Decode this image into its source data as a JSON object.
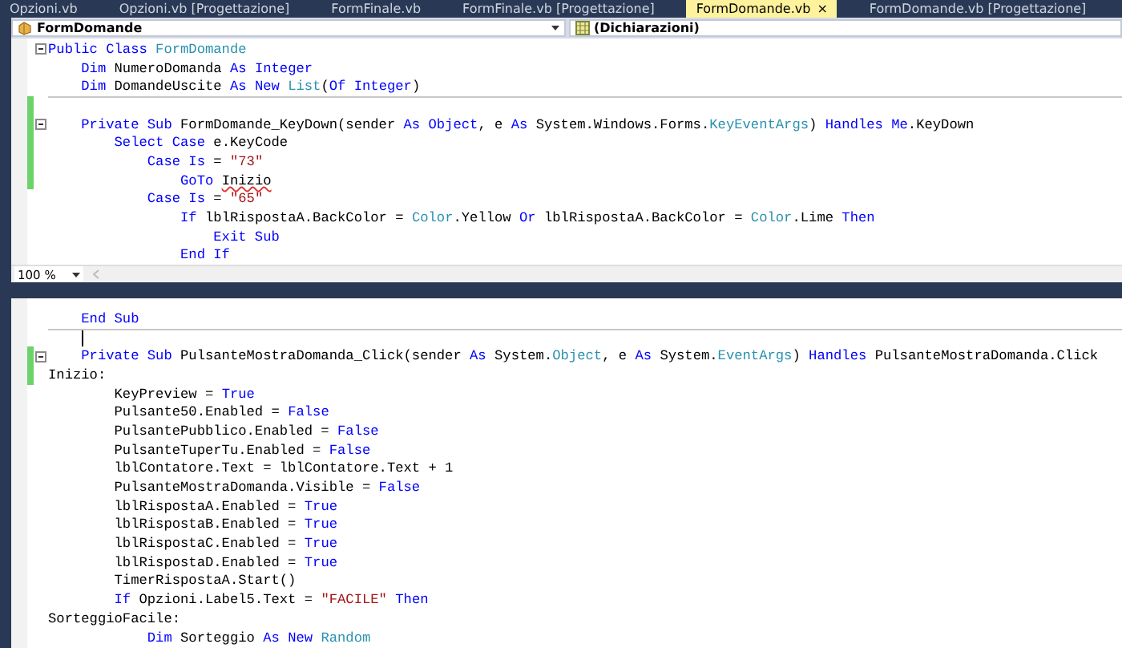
{
  "tabs": [
    {
      "label": "Opzioni.vb",
      "selected": false
    },
    {
      "label": "Opzioni.vb [Progettazione]",
      "selected": false
    },
    {
      "label": "FormFinale.vb",
      "selected": false
    },
    {
      "label": "FormFinale.vb [Progettazione]",
      "selected": false
    },
    {
      "label": "FormDomande.vb",
      "selected": true,
      "close": "×"
    },
    {
      "label": "FormDomande.vb [Progettazione]",
      "selected": false
    }
  ],
  "navigation": {
    "type_list": "FormDomande",
    "member_list": "(Dichiarazioni)"
  },
  "top_pane": {
    "zoom": "100 %",
    "lines": [
      {
        "changed": false,
        "fold": true,
        "segments": [
          {
            "text": "Public Class ",
            "kind": "keyword"
          },
          {
            "text": "FormDomande",
            "kind": "type"
          }
        ]
      },
      {
        "changed": false,
        "segments": [
          {
            "text": "    Dim ",
            "kind": "keyword"
          },
          {
            "text": "NumeroDomanda ",
            "kind": "plain"
          },
          {
            "text": "As Integer",
            "kind": "keyword"
          }
        ]
      },
      {
        "changed": false,
        "segments": [
          {
            "text": "    Dim ",
            "kind": "keyword"
          },
          {
            "text": "DomandeUscite ",
            "kind": "plain"
          },
          {
            "text": "As New ",
            "kind": "keyword"
          },
          {
            "text": "List",
            "kind": "type"
          },
          {
            "text": "(",
            "kind": "plain"
          },
          {
            "text": "Of Integer",
            "kind": "keyword"
          },
          {
            "text": ")",
            "kind": "plain"
          }
        ]
      },
      {
        "changed": true,
        "separator_above": true
      },
      {
        "changed": true,
        "fold": true,
        "segments": [
          {
            "text": "    Private Sub ",
            "kind": "keyword"
          },
          {
            "text": "FormDomande_KeyDown(sender ",
            "kind": "plain"
          },
          {
            "text": "As Object",
            "kind": "keyword"
          },
          {
            "text": ", e ",
            "kind": "plain"
          },
          {
            "text": "As ",
            "kind": "keyword"
          },
          {
            "text": "System.Windows.Forms.",
            "kind": "plain"
          },
          {
            "text": "KeyEventArgs",
            "kind": "type"
          },
          {
            "text": ") ",
            "kind": "plain"
          },
          {
            "text": "Handles Me",
            "kind": "keyword"
          },
          {
            "text": ".KeyDown",
            "kind": "plain"
          }
        ]
      },
      {
        "changed": true,
        "segments": [
          {
            "text": "        Select Case ",
            "kind": "keyword"
          },
          {
            "text": "e.KeyCode",
            "kind": "plain"
          }
        ]
      },
      {
        "changed": true,
        "segments": [
          {
            "text": "            Case Is ",
            "kind": "keyword"
          },
          {
            "text": "= ",
            "kind": "plain"
          },
          {
            "text": "\"73\"",
            "kind": "string"
          }
        ]
      },
      {
        "changed": true,
        "segments": [
          {
            "text": "                GoTo ",
            "kind": "keyword"
          },
          {
            "text": "Inizio",
            "kind": "error"
          }
        ]
      },
      {
        "changed": false,
        "segments": [
          {
            "text": "            Case Is ",
            "kind": "keyword"
          },
          {
            "text": "= ",
            "kind": "plain"
          },
          {
            "text": "\"65\"",
            "kind": "string"
          }
        ]
      },
      {
        "changed": false,
        "segments": [
          {
            "text": "                If ",
            "kind": "keyword"
          },
          {
            "text": "lblRispostaA.BackColor = ",
            "kind": "plain"
          },
          {
            "text": "Color",
            "kind": "type"
          },
          {
            "text": ".Yellow ",
            "kind": "plain"
          },
          {
            "text": "Or ",
            "kind": "keyword"
          },
          {
            "text": "lblRispostaA.BackColor = ",
            "kind": "plain"
          },
          {
            "text": "Color",
            "kind": "type"
          },
          {
            "text": ".Lime ",
            "kind": "plain"
          },
          {
            "text": "Then",
            "kind": "keyword"
          }
        ]
      },
      {
        "changed": false,
        "segments": [
          {
            "text": "                    Exit Sub",
            "kind": "keyword"
          }
        ]
      },
      {
        "changed": false,
        "segments": [
          {
            "text": "                End If",
            "kind": "keyword"
          }
        ]
      }
    ]
  },
  "bottom_pane": {
    "lines": [
      {
        "changed": false,
        "segments": [
          {
            "text": "    End Sub",
            "kind": "keyword"
          }
        ]
      },
      {
        "changed": false,
        "separator_above": true,
        "caret": true
      },
      {
        "changed": true,
        "fold": true,
        "segments": [
          {
            "text": "    Private Sub ",
            "kind": "keyword"
          },
          {
            "text": "PulsanteMostraDomanda_Click(sender ",
            "kind": "plain"
          },
          {
            "text": "As ",
            "kind": "keyword"
          },
          {
            "text": "System.",
            "kind": "plain"
          },
          {
            "text": "Object",
            "kind": "type"
          },
          {
            "text": ", e ",
            "kind": "plain"
          },
          {
            "text": "As ",
            "kind": "keyword"
          },
          {
            "text": "System.",
            "kind": "plain"
          },
          {
            "text": "EventArgs",
            "kind": "type"
          },
          {
            "text": ") ",
            "kind": "plain"
          },
          {
            "text": "Handles ",
            "kind": "keyword"
          },
          {
            "text": "PulsanteMostraDomanda.Click",
            "kind": "plain"
          }
        ]
      },
      {
        "changed": true,
        "segments": [
          {
            "text": "Inizio:",
            "kind": "plain"
          }
        ]
      },
      {
        "changed": false,
        "segments": [
          {
            "text": "        KeyPreview = ",
            "kind": "plain"
          },
          {
            "text": "True",
            "kind": "keyword"
          }
        ]
      },
      {
        "changed": false,
        "segments": [
          {
            "text": "        Pulsante50.Enabled = ",
            "kind": "plain"
          },
          {
            "text": "False",
            "kind": "keyword"
          }
        ]
      },
      {
        "changed": false,
        "segments": [
          {
            "text": "        PulsantePubblico.Enabled = ",
            "kind": "plain"
          },
          {
            "text": "False",
            "kind": "keyword"
          }
        ]
      },
      {
        "changed": false,
        "segments": [
          {
            "text": "        PulsanteTuperTu.Enabled = ",
            "kind": "plain"
          },
          {
            "text": "False",
            "kind": "keyword"
          }
        ]
      },
      {
        "changed": false,
        "segments": [
          {
            "text": "        lblContatore.Text = lblContatore.Text + 1",
            "kind": "plain"
          }
        ]
      },
      {
        "changed": false,
        "segments": [
          {
            "text": "        PulsanteMostraDomanda.Visible = ",
            "kind": "plain"
          },
          {
            "text": "False",
            "kind": "keyword"
          }
        ]
      },
      {
        "changed": false,
        "segments": [
          {
            "text": "        lblRispostaA.Enabled = ",
            "kind": "plain"
          },
          {
            "text": "True",
            "kind": "keyword"
          }
        ]
      },
      {
        "changed": false,
        "segments": [
          {
            "text": "        lblRispostaB.Enabled = ",
            "kind": "plain"
          },
          {
            "text": "True",
            "kind": "keyword"
          }
        ]
      },
      {
        "changed": false,
        "segments": [
          {
            "text": "        lblRispostaC.Enabled = ",
            "kind": "plain"
          },
          {
            "text": "True",
            "kind": "keyword"
          }
        ]
      },
      {
        "changed": false,
        "segments": [
          {
            "text": "        lblRispostaD.Enabled = ",
            "kind": "plain"
          },
          {
            "text": "True",
            "kind": "keyword"
          }
        ]
      },
      {
        "changed": false,
        "segments": [
          {
            "text": "        TimerRispostaA.Start()",
            "kind": "plain"
          }
        ]
      },
      {
        "changed": false,
        "segments": [
          {
            "text": "        If ",
            "kind": "keyword"
          },
          {
            "text": "Opzioni.Label5.Text = ",
            "kind": "plain"
          },
          {
            "text": "\"FACILE\" ",
            "kind": "string"
          },
          {
            "text": "Then",
            "kind": "keyword"
          }
        ]
      },
      {
        "changed": false,
        "segments": [
          {
            "text": "SorteggioFacile:",
            "kind": "plain"
          }
        ]
      },
      {
        "changed": false,
        "segments": [
          {
            "text": "            Dim ",
            "kind": "keyword"
          },
          {
            "text": "Sorteggio ",
            "kind": "plain"
          },
          {
            "text": "As New ",
            "kind": "keyword"
          },
          {
            "text": "Random",
            "kind": "type"
          }
        ]
      }
    ]
  }
}
